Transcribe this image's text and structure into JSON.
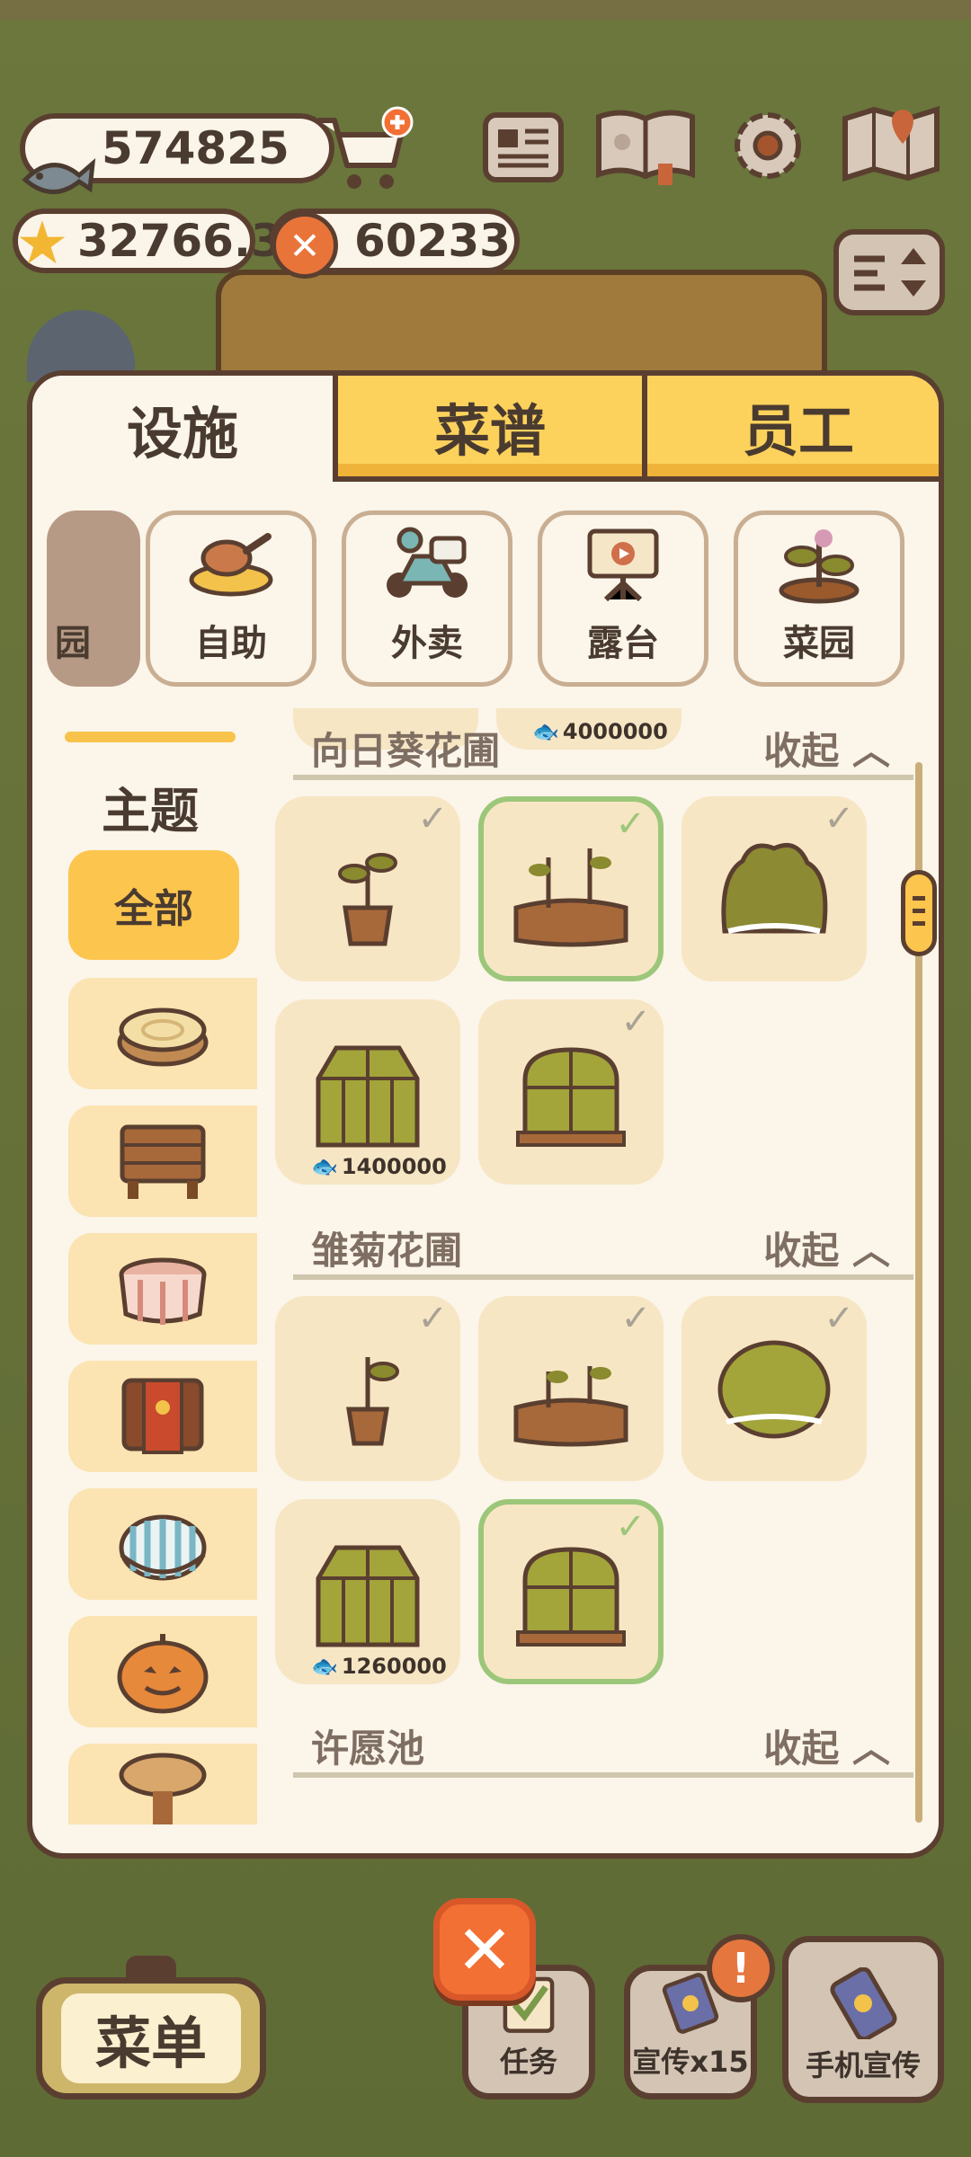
{
  "hud": {
    "fish": "574825",
    "stars": "32766.3",
    "coins": "60233",
    "coin_glyph": "✕"
  },
  "tabs": [
    {
      "label": "设施",
      "active": true
    },
    {
      "label": "菜谱",
      "active": false
    },
    {
      "label": "员工",
      "active": false
    }
  ],
  "categories": [
    {
      "label": "园",
      "partial": true
    },
    {
      "label": "自助"
    },
    {
      "label": "外卖"
    },
    {
      "label": "露台"
    },
    {
      "label": "菜园"
    }
  ],
  "sidebar": {
    "title": "主题",
    "all_label": "全部",
    "items": [
      "tree-stump",
      "wooden-table",
      "checkered-table",
      "paw-cloth-table",
      "striped-round-table",
      "pumpkin",
      "round-wooden-table"
    ]
  },
  "top_price": "4000000",
  "sections": [
    {
      "name": "向日葵花圃",
      "collapse_label": "收起",
      "items": [
        {
          "art": "potted-sprout",
          "owned": true,
          "selected": false
        },
        {
          "art": "soil-sprouts",
          "owned": true,
          "selected": true
        },
        {
          "art": "green-bush",
          "owned": true,
          "selected": false
        },
        {
          "art": "greenhouse",
          "owned": false,
          "price": "1400000"
        },
        {
          "art": "cold-frame",
          "owned": true,
          "selected": false
        }
      ]
    },
    {
      "name": "雏菊花圃",
      "collapse_label": "收起",
      "items": [
        {
          "art": "potted-sprout",
          "owned": true,
          "selected": false
        },
        {
          "art": "soil-sprouts",
          "owned": true,
          "selected": false
        },
        {
          "art": "round-bush",
          "owned": true,
          "selected": false
        },
        {
          "art": "greenhouse",
          "owned": false,
          "price": "1260000"
        },
        {
          "art": "cold-frame",
          "owned": true,
          "selected": true
        }
      ]
    },
    {
      "name": "许愿池",
      "collapse_label": "收起"
    }
  ],
  "bottom": {
    "menu_label": "菜单",
    "close_glyph": "✕",
    "task_label": "任务",
    "promo_label": "宣传x15",
    "phone_label": "手机宣传",
    "alert_glyph": "!"
  },
  "colors": {
    "panel": "#fbf5ea",
    "tab_active": "#fbf5ea",
    "tab_inactive": "#fdd25c",
    "selected_border": "#9cc77a",
    "close_button": "#f27033"
  }
}
